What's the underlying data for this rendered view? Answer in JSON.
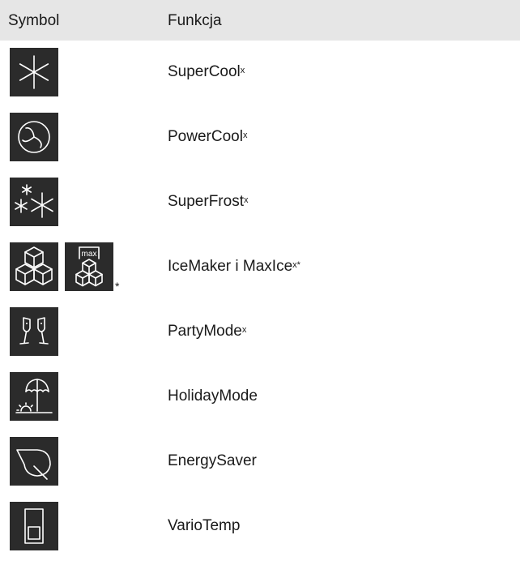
{
  "header": {
    "symbol": "Symbol",
    "function": "Funkcja"
  },
  "rows": [
    {
      "name": "SuperCool",
      "mark": "x",
      "icon": "snowflake-icon"
    },
    {
      "name": "PowerCool",
      "mark": "x",
      "icon": "fan-icon"
    },
    {
      "name": "SuperFrost",
      "mark": "x",
      "icon": "double-snowflake-icon"
    },
    {
      "name": "IceMaker i MaxIce",
      "mark": "x*",
      "icon": "ice-cubes-icon",
      "icon2": "ice-cubes-max-icon",
      "icon2_label": "max",
      "note": "*"
    },
    {
      "name": "PartyMode",
      "mark": "x",
      "icon": "champagne-glasses-icon"
    },
    {
      "name": "HolidayMode",
      "mark": "",
      "icon": "beach-umbrella-icon"
    },
    {
      "name": "EnergySaver",
      "mark": "",
      "icon": "leaf-icon"
    },
    {
      "name": "VarioTemp",
      "mark": "",
      "icon": "vario-drawer-icon"
    }
  ]
}
